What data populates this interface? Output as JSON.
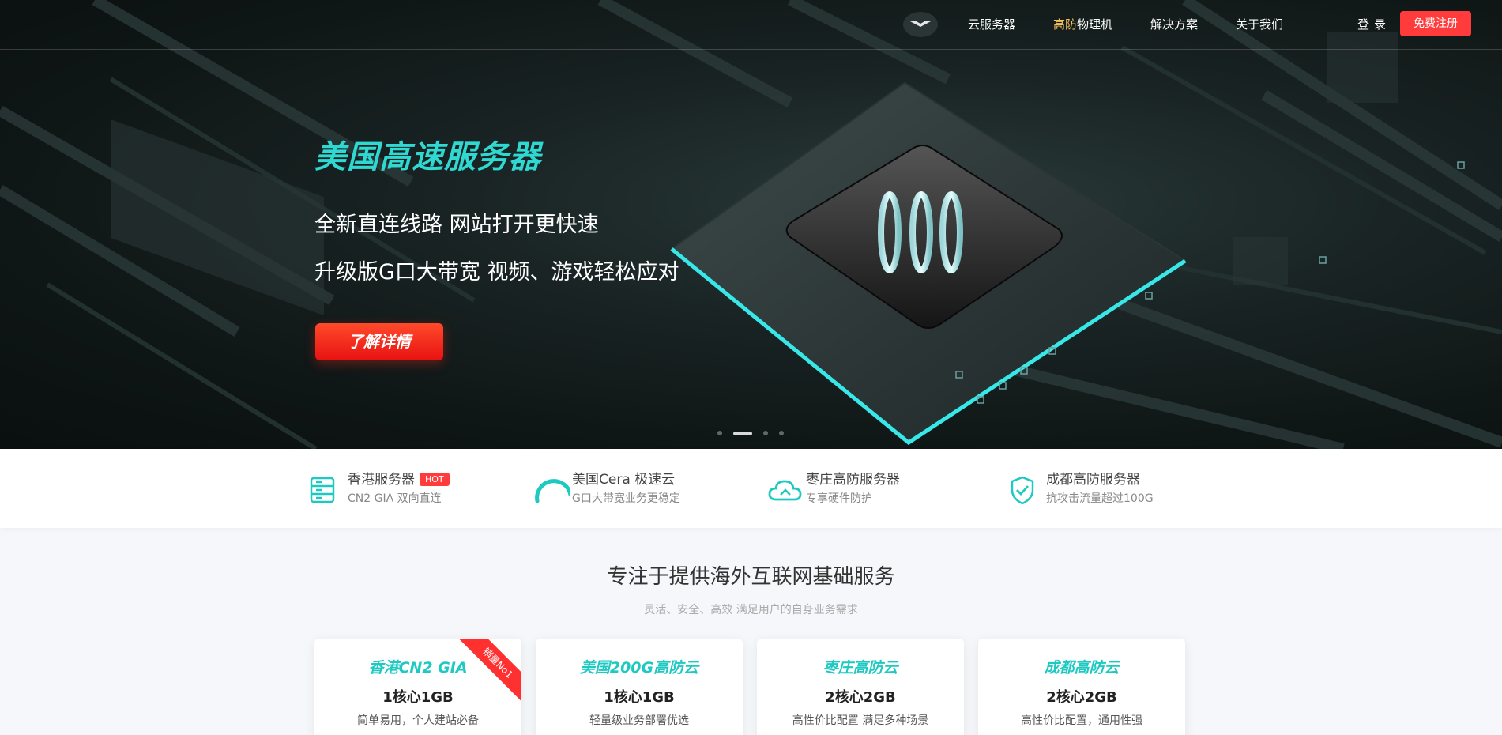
{
  "colors": {
    "accent": "#1ec9c2",
    "cta": "#ff3b3b",
    "nav_highlight": "#f5c45b"
  },
  "nav": {
    "logo_icon": "brand-logo-icon",
    "items": [
      {
        "label": "云服务器"
      },
      {
        "label_hl": "高防",
        "label_rest": "物理机"
      },
      {
        "label": "解决方案"
      },
      {
        "label": "关于我们"
      }
    ],
    "login": "登录",
    "register": "免费注册"
  },
  "hero": {
    "title": "美国高速服务器",
    "line1": "全新直连线路 网站打开更快速",
    "line2": "升级版G口大带宽 视频、游戏轻松应对",
    "cta": "了解详情",
    "slides": 4,
    "active_slide": 1
  },
  "features": [
    {
      "icon": "server-icon",
      "name": "香港服务器",
      "badge": "HOT",
      "desc": "CN2 GIA 双向直连"
    },
    {
      "icon": "speed-gauge-icon",
      "name": "美国Cera 极速云",
      "desc": "G口大带宽业务更稳定"
    },
    {
      "icon": "cloud-icon",
      "name": "枣庄高防服务器",
      "desc": "专享硬件防护"
    },
    {
      "icon": "shield-check-icon",
      "name": "成都高防服务器",
      "desc": "抗攻击流量超过100G"
    }
  ],
  "section": {
    "title": "专注于提供海外互联网基础服务",
    "subtitle": "灵活、安全、高效 满足用户的自身业务需求"
  },
  "cards": [
    {
      "title": "香港CN2 GIA",
      "spec": "1核心1GB",
      "desc": "简单易用，个人建站必备",
      "ribbon": "销量No1"
    },
    {
      "title": "美国200G高防云",
      "spec": "1核心1GB",
      "desc": "轻量级业务部署优选"
    },
    {
      "title": "枣庄高防云",
      "spec": "2核心2GB",
      "desc": "高性价比配置 满足多种场景"
    },
    {
      "title": "成都高防云",
      "spec": "2核心2GB",
      "desc": "高性价比配置，通用性强"
    }
  ]
}
